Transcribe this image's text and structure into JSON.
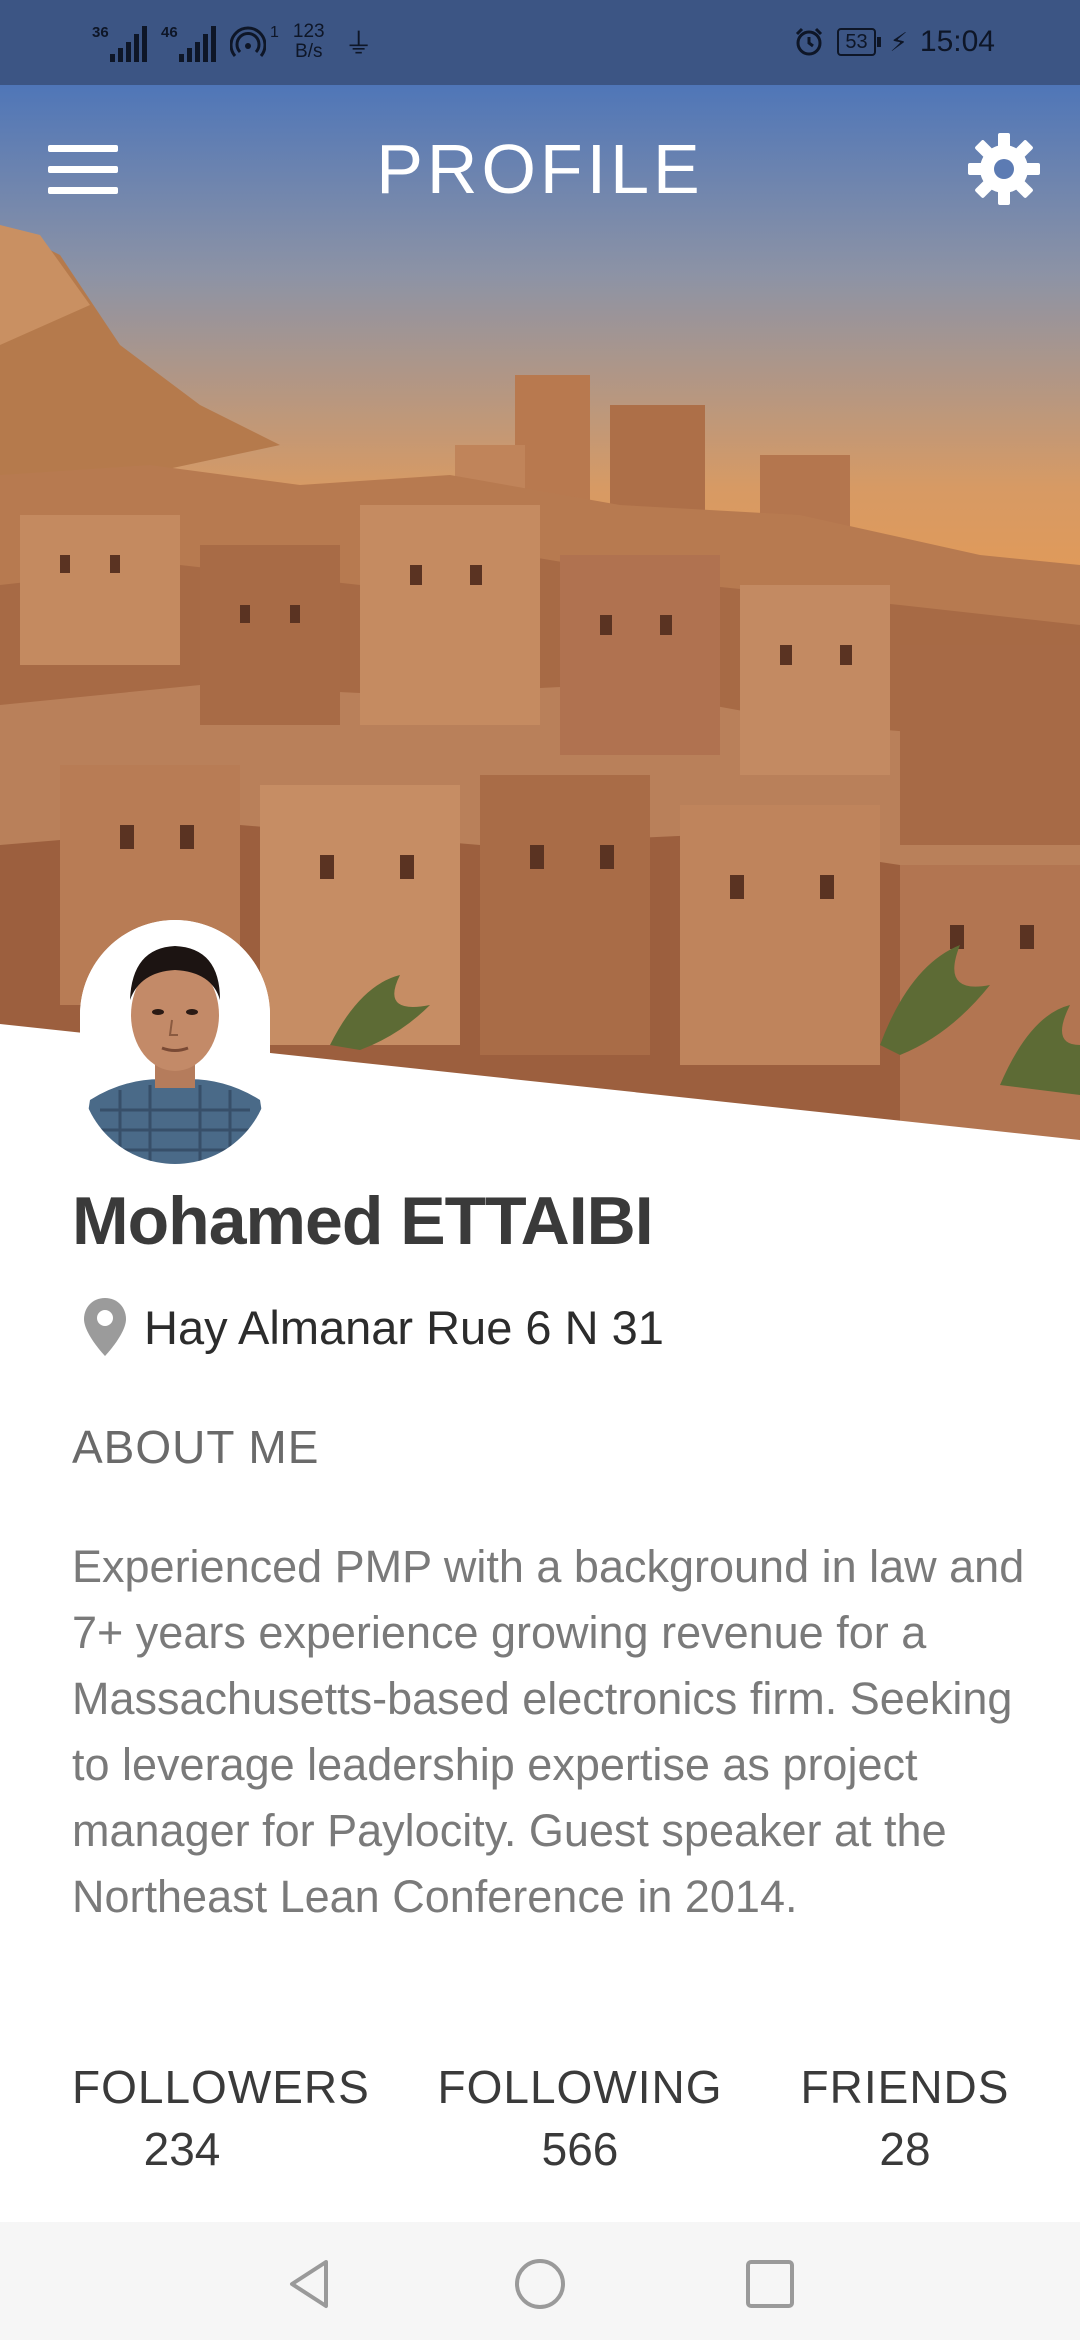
{
  "status_bar": {
    "sim1": "36",
    "sim2": "46",
    "hotspot_count": "1",
    "net_speed_value": "123",
    "net_speed_unit": "B/s",
    "battery": "53",
    "time": "15:04",
    "icons": [
      "signal-icon",
      "hotspot-icon",
      "usb-icon",
      "alarm-icon",
      "battery-icon",
      "charging-icon"
    ]
  },
  "header": {
    "title": "PROFILE",
    "menu_icon": "hamburger-menu-icon",
    "settings_icon": "gear-icon"
  },
  "profile": {
    "name": "Mohamed ETTAIBI",
    "location": "Hay Almanar Rue 6 N 31",
    "about_heading": "ABOUT ME",
    "about_text": "Experienced PMP with a background in law and 7+ years experience growing revenue for a Massachusetts-based electronics firm. Seeking to leverage leadership expertise as project manager for Paylocity. Guest speaker at the Northeast Lean Conference in 2014."
  },
  "stats": [
    {
      "label": "FOLLOWERS",
      "value": "234"
    },
    {
      "label": "FOLLOWING",
      "value": "566"
    },
    {
      "label": "FRIENDS",
      "value": "28"
    }
  ],
  "nav": {
    "back_icon": "back-triangle-icon",
    "home_icon": "home-circle-icon",
    "recents_icon": "recents-square-icon"
  },
  "colors": {
    "status_bar_bg": "#3c5584",
    "name_text": "#3a3a3a",
    "body_text": "#7a7a7a",
    "nav_bg": "#f6f6f6"
  }
}
